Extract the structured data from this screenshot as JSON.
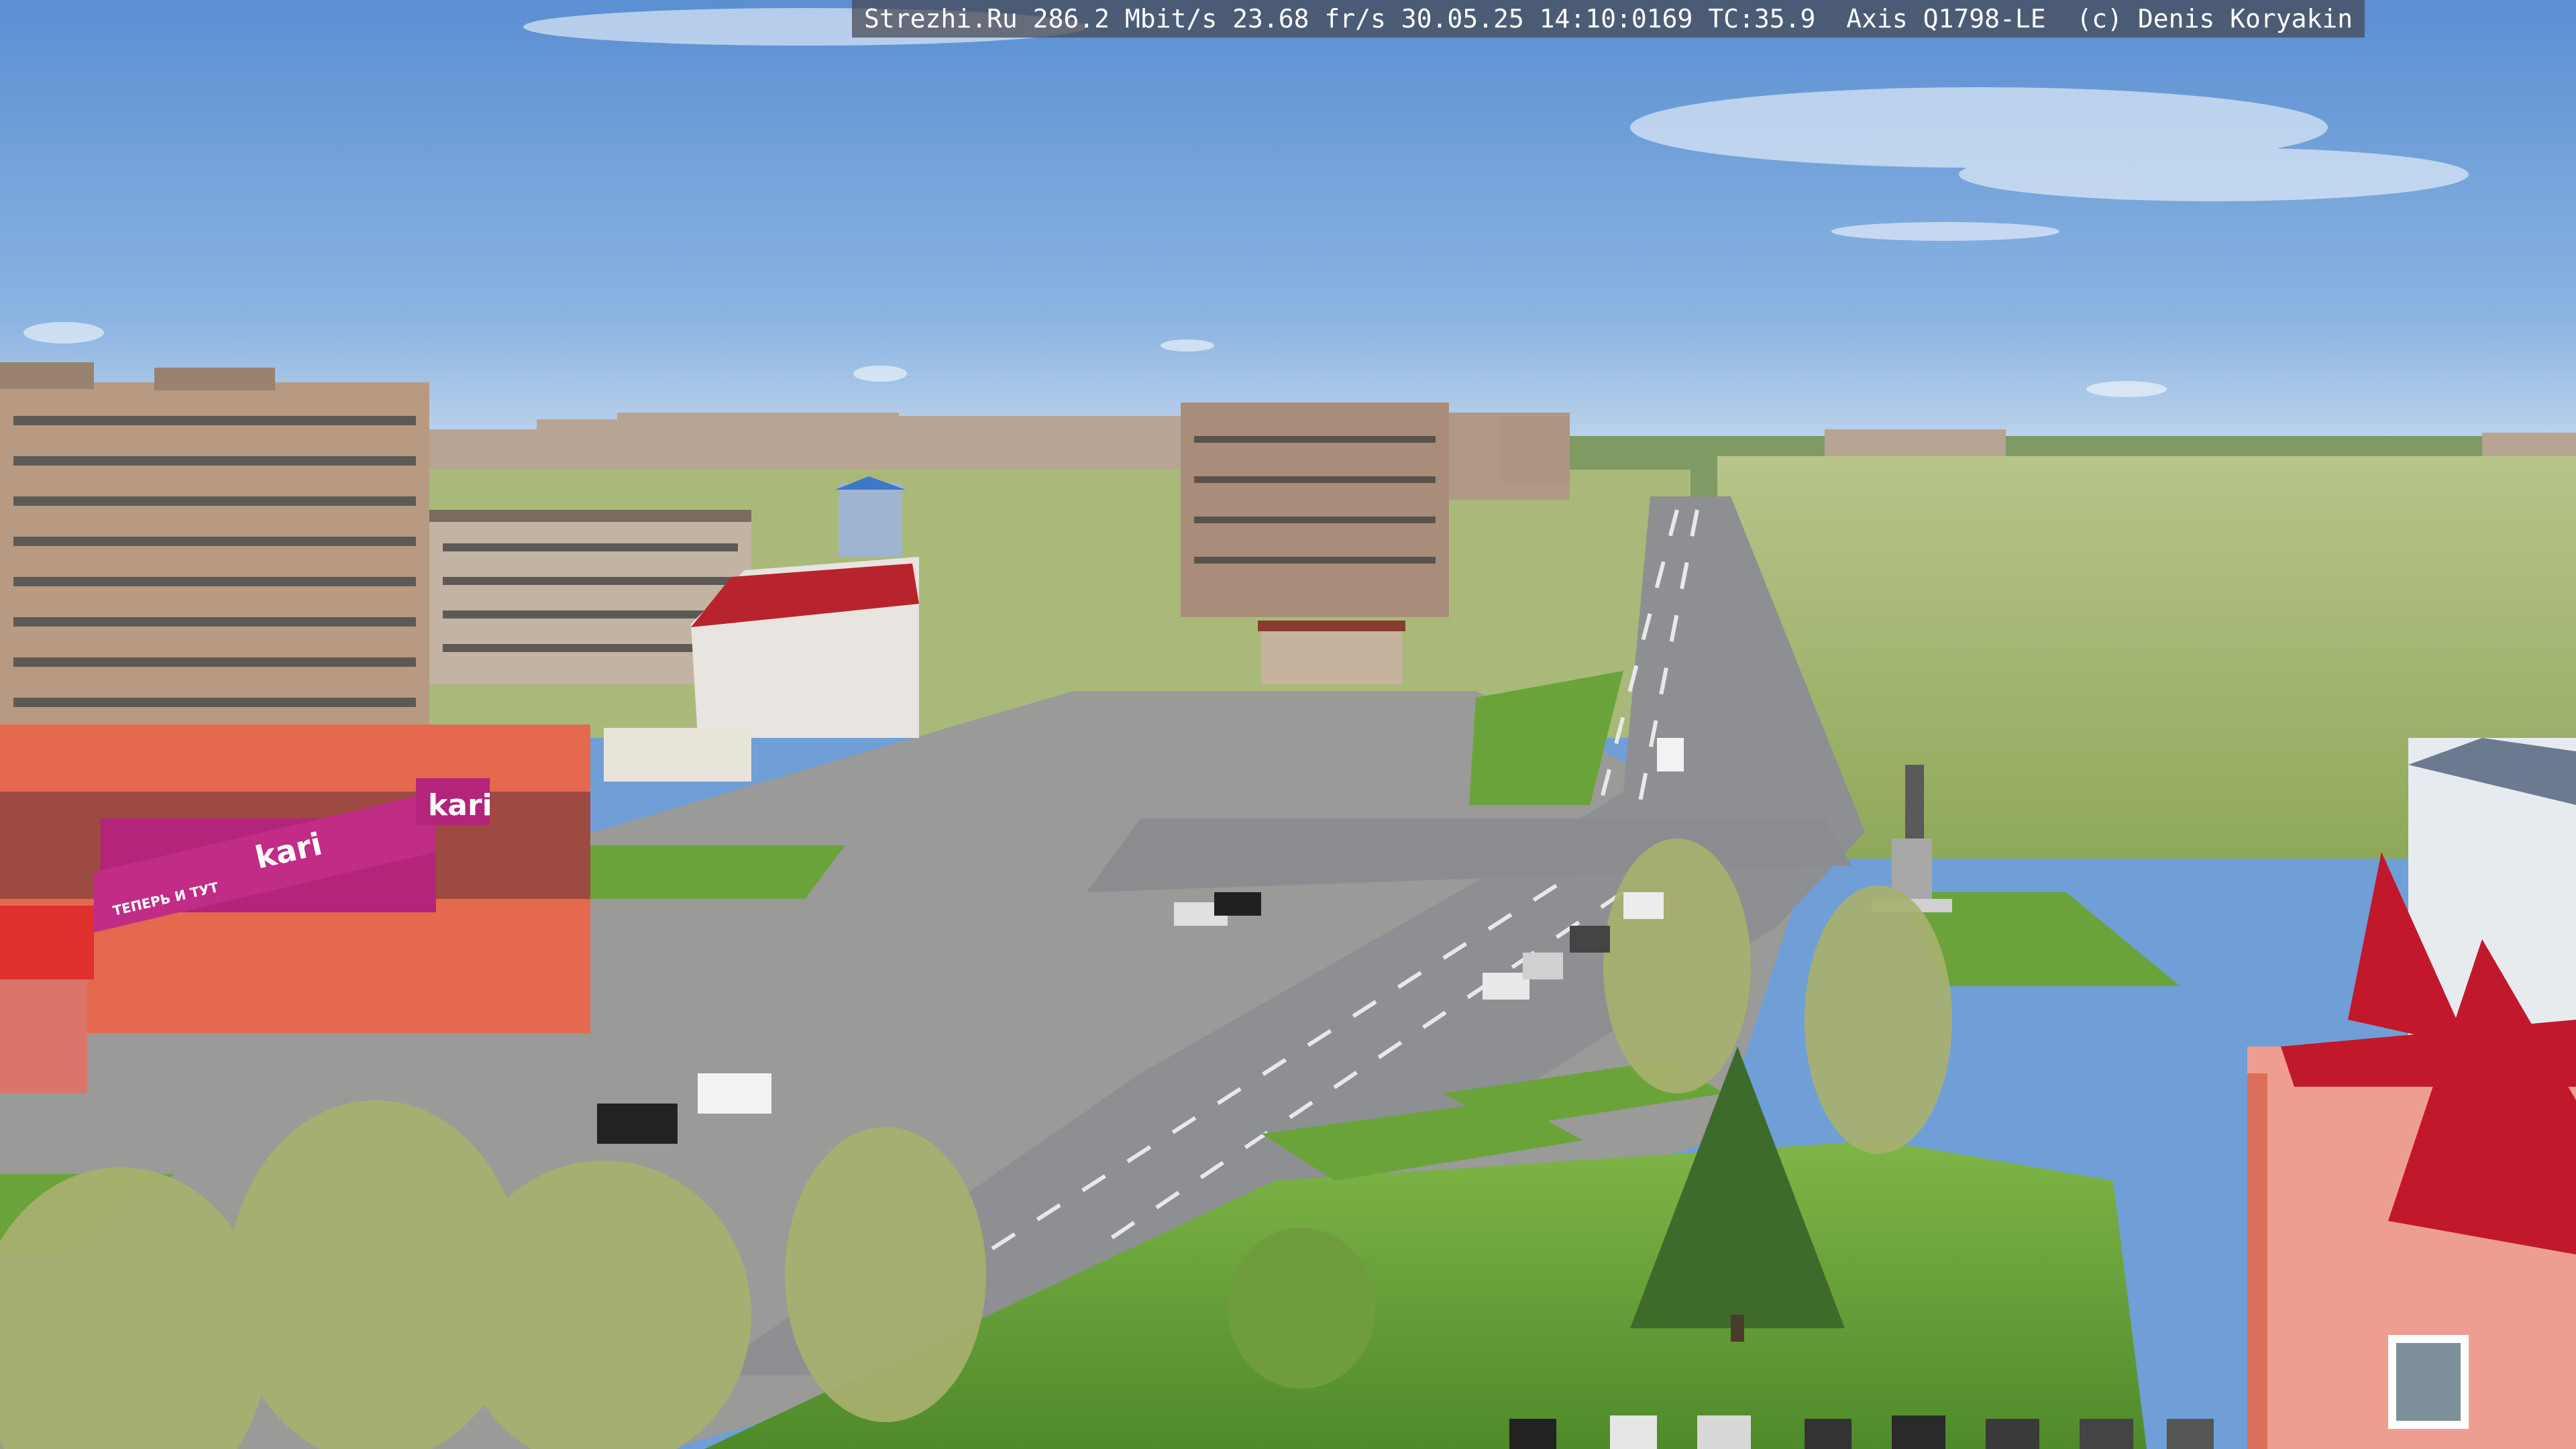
{
  "camera_overlay": {
    "text": "Strezhi.Ru 286.2 Mbit/s 23.68 fr/s 30.05.25 14:10:0169 TC:35.9  Axis Q1798-LE  (c) Denis Koryakin"
  },
  "storefront": {
    "brand": "kari",
    "brand_secondary": "kari",
    "tagline": "ТЕПЕРЬ И ТУТ"
  },
  "colors": {
    "sky_top": "#5f93d3",
    "sky_bottom": "#b9d3ec",
    "road": "#8d8f92",
    "grass": "#6aa33a",
    "kari_magenta": "#b3247a",
    "roof_red": "#b8242e",
    "building_brick": "#b89a82"
  }
}
